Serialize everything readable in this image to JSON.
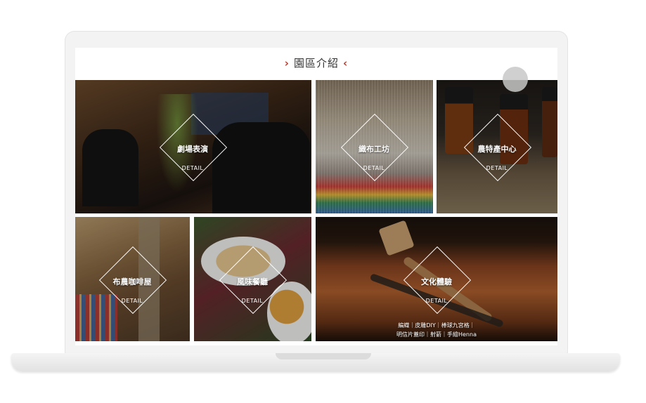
{
  "section": {
    "title": "園區介紹",
    "chevron_left": "›",
    "chevron_right": "‹"
  },
  "tiles": [
    {
      "name": "劇場表演",
      "detail": "DETAIL"
    },
    {
      "name": "織布工坊",
      "detail": "DETAIL"
    },
    {
      "name": "農特產中心",
      "detail": "DETAIL"
    },
    {
      "name": "布農咖啡屋",
      "detail": "DETAIL"
    },
    {
      "name": "風味餐廳",
      "detail": "DETAIL"
    },
    {
      "name": "文化體驗",
      "detail": "DETAIL",
      "sub_line1": "編織｜皮雕DIY｜棒球九宮格｜",
      "sub_line2": "明信片蓋印｜射箭｜手繪Henna"
    }
  ],
  "colors": {
    "accent": "#c0392b",
    "title_text": "#333333"
  }
}
